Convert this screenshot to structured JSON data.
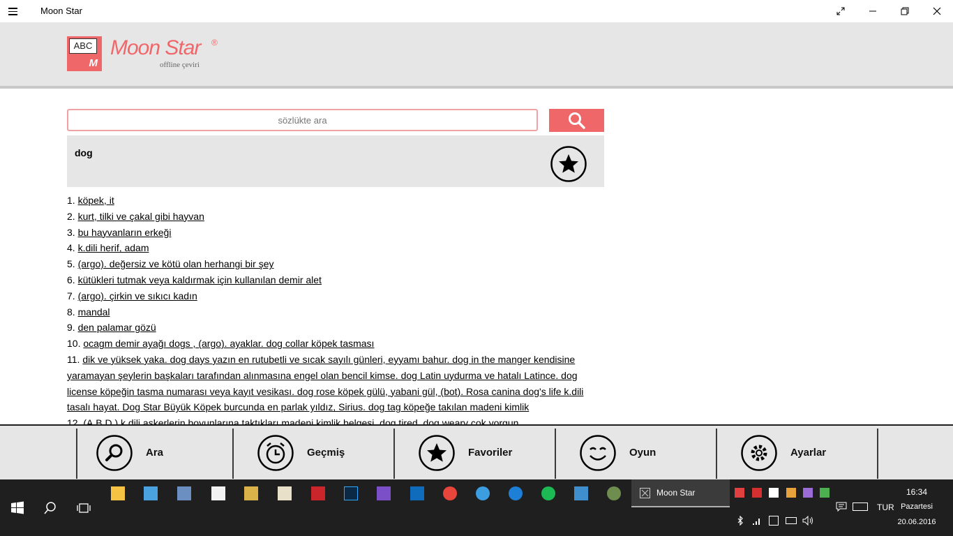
{
  "window": {
    "title": "Moon Star"
  },
  "brand": {
    "logo_text": "ABC",
    "logo_letter": "M",
    "name": "Moon Star",
    "registered": "®",
    "tagline": "offline çeviri",
    "accent_color": "#f0676a"
  },
  "search": {
    "placeholder": "sözlükte ara",
    "button_icon": "search-icon"
  },
  "entry": {
    "word": "dog",
    "favorite_icon": "star-icon",
    "definitions": [
      {
        "n": "1.",
        "text": " köpek, it"
      },
      {
        "n": "2.",
        "text": " kurt, tilki ve çakal gibi  hayvan"
      },
      {
        "n": "3.",
        "text": " bu hayvanların erkeği"
      },
      {
        "n": "4.",
        "text": " k.dili herif,  adam"
      },
      {
        "n": "5.",
        "text": " (argo). değersiz ve kötü olan herhangi  bir şey"
      },
      {
        "n": "6.",
        "text": " kütükleri tutmak veya kaldırmak için   kullanılan demir alet"
      },
      {
        "n": "7.",
        "text": " (argo). çirkin ve sıkıcı  kadın"
      },
      {
        "n": "8.",
        "text": " mandal"
      },
      {
        "n": "9.",
        "text": " den palamar gözü"
      },
      {
        "n": "10.",
        "text": " ocagm  demir ayağı dogs , (argo). ayaklar. dog collar  köpek tasması"
      },
      {
        "n": "11.",
        "text": " dik ve yüksek yaka. dog  days yazın en rutubetli ve sıcak sayılı günleri,  eyyamı bahur. dog in the manger kendisine  yaramayan şeylerin başkaları tarafından alınmasına engel olan bencil kimse. dog Latin  uydurma ve hatalı Latince. dog license  köpeğin tasma numarası veya kayıt vesikası.  dog rose köpek gülü, yabani gül, (bot). Rosa  canina dog's life k.dili tasalı hayat. Dog Star  Büyük Köpek burcunda en parlak yıldız,  Sirius. dog tag köpeğe takılan madeni kimlik"
      },
      {
        "n": "12.",
        "text": " (A.B.D.)  k.dili askerlerin boyunlarına taktıkları   madeni kimlik belgesi. dog tired, dog weary çok yorgun"
      }
    ]
  },
  "nav": [
    {
      "label": "Ara",
      "icon": "search-icon"
    },
    {
      "label": "Geçmiş",
      "icon": "alarm-clock-icon"
    },
    {
      "label": "Favoriler",
      "icon": "star-icon"
    },
    {
      "label": "Oyun",
      "icon": "smile-icon"
    },
    {
      "label": "Ayarlar",
      "icon": "gear-icon"
    }
  ],
  "taskbar": {
    "active_app": "Moon Star",
    "language": "TUR",
    "time": "16:34",
    "day": "Pazartesi",
    "date": "20.06.2016"
  }
}
